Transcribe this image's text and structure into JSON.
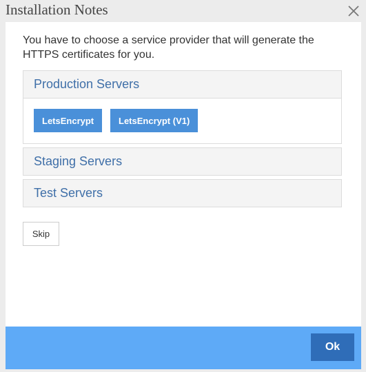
{
  "dialog": {
    "title": "Installation Notes",
    "intro": "You have to choose a service provider that will generate the HTTPS certificates for you."
  },
  "panels": [
    {
      "heading": "Production Servers",
      "buttons": [
        "LetsEncrypt",
        "LetsEncrypt (V1)"
      ]
    },
    {
      "heading": "Staging Servers"
    },
    {
      "heading": "Test Servers"
    }
  ],
  "actions": {
    "skip_label": "Skip",
    "ok_label": "Ok"
  },
  "colors": {
    "accent": "#4a90d9",
    "footer": "#5eaaf7",
    "ok_button": "#2f6db8",
    "heading_text": "#3f6fa8"
  },
  "icons": {
    "close": "close-icon"
  }
}
